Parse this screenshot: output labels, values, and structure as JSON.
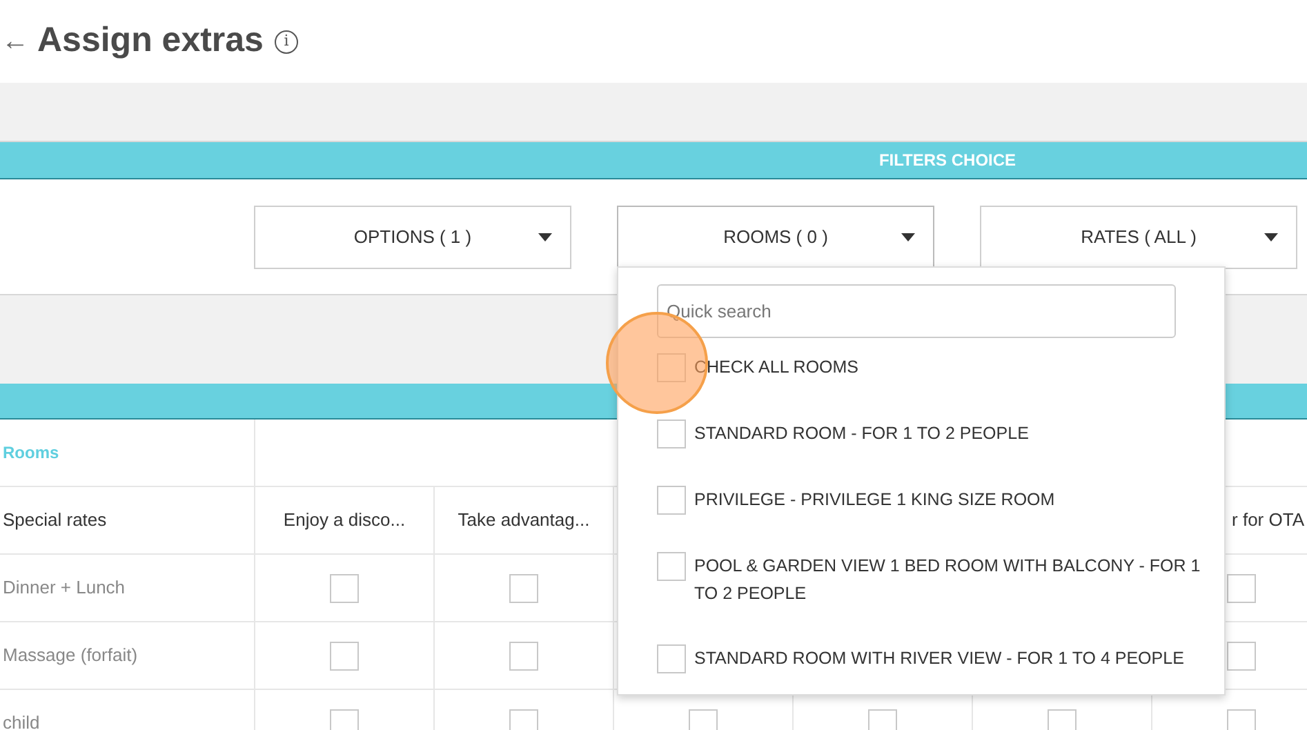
{
  "header": {
    "back": "←",
    "title": "Assign extras",
    "info": "i"
  },
  "filters": {
    "title": "FILTERS CHOICE",
    "dropdowns": [
      {
        "label": "OPTIONS ( 1 )",
        "expanded": false
      },
      {
        "label": "ROOMS ( 0 )",
        "expanded": true
      },
      {
        "label": "RATES ( ALL )",
        "expanded": false
      }
    ]
  },
  "table": {
    "group_label": "Rooms",
    "row_header": "Special rates",
    "columns_before_menu": [
      "Enjoy a disco...",
      "Take advantag..."
    ],
    "columns_after_menu": [
      "r for OTA"
    ],
    "rows": [
      {
        "label": "Dinner + Lunch",
        "checks_before_menu": [
          false,
          false
        ],
        "checks_after_menu": [
          false
        ]
      },
      {
        "label": "Massage (forfait)",
        "checks_before_menu": [
          false,
          false
        ],
        "checks_after_menu": [
          false
        ]
      },
      {
        "label": "child",
        "checks_before_menu": [
          false,
          false
        ],
        "checks_under_menu": [
          false,
          false,
          false
        ],
        "checks_after_menu": [
          false
        ]
      }
    ]
  },
  "rooms_menu": {
    "search": {
      "placeholder": "Quick search"
    },
    "items": [
      {
        "label": "CHECK ALL ROOMS",
        "checked": false
      },
      {
        "label": "STANDARD ROOM - FOR 1 TO 2 PEOPLE",
        "checked": false
      },
      {
        "label": "PRIVILEGE - PRIVILEGE 1 KING SIZE ROOM",
        "checked": false
      },
      {
        "label": "POOL & GARDEN VIEW 1 BED ROOM WITH BALCONY - FOR 1 TO 2 PEOPLE",
        "checked": false
      },
      {
        "label": "STANDARD ROOM WITH RIVER VIEW - FOR 1 TO 4 PEOPLE",
        "checked": false
      }
    ]
  }
}
